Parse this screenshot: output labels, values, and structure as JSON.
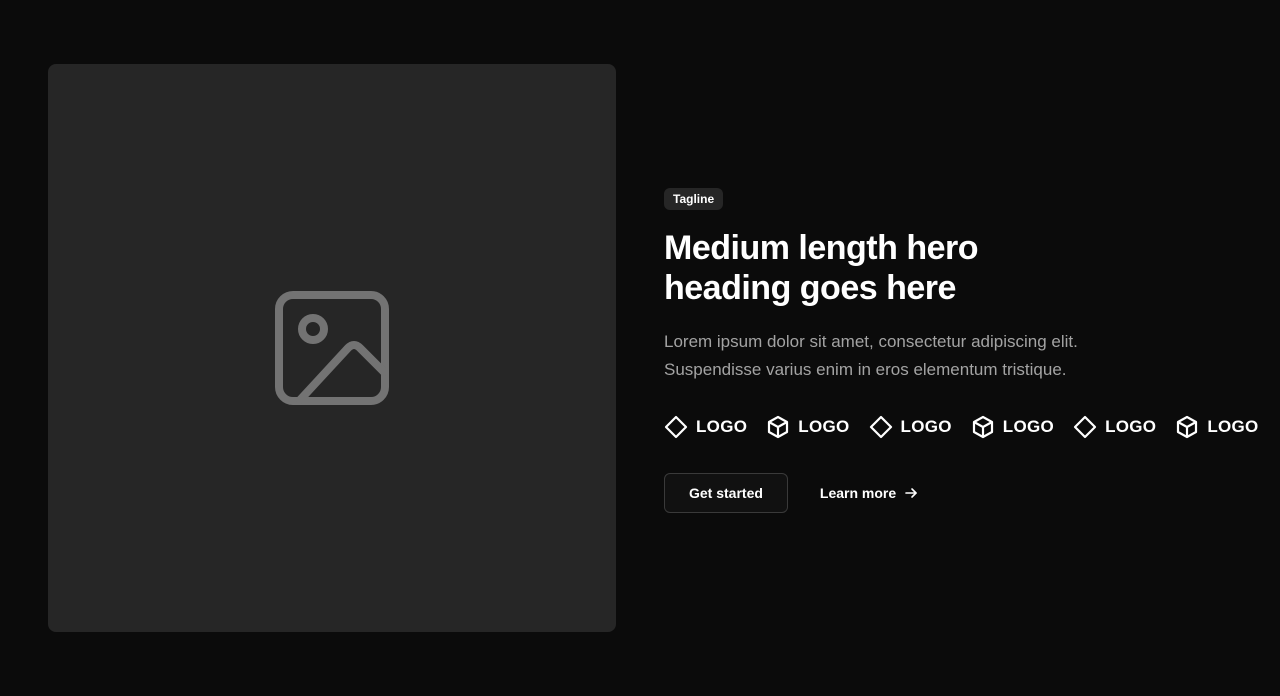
{
  "hero": {
    "image_placeholder_icon": "image-icon",
    "tagline": "Tagline",
    "heading_line1": "Medium length hero",
    "heading_line2": "heading goes here",
    "description_line1": "Lorem ipsum dolor sit amet, consectetur adipiscing elit.",
    "description_line2": "Suspendisse varius enim in eros elementum tristique.",
    "logos": [
      {
        "icon": "diamond-icon",
        "label": "LOGO"
      },
      {
        "icon": "cube-icon",
        "label": "LOGO"
      },
      {
        "icon": "diamond-icon",
        "label": "LOGO"
      },
      {
        "icon": "cube-icon",
        "label": "LOGO"
      },
      {
        "icon": "diamond-icon",
        "label": "LOGO"
      },
      {
        "icon": "cube-icon",
        "label": "LOGO"
      }
    ],
    "primary_button": "Get started",
    "secondary_button": "Learn more",
    "secondary_button_icon": "arrow-right-icon"
  },
  "colors": {
    "background": "#0b0b0b",
    "placeholder": "#262626",
    "text": "#ffffff",
    "muted_text": "#a3a3a3"
  }
}
